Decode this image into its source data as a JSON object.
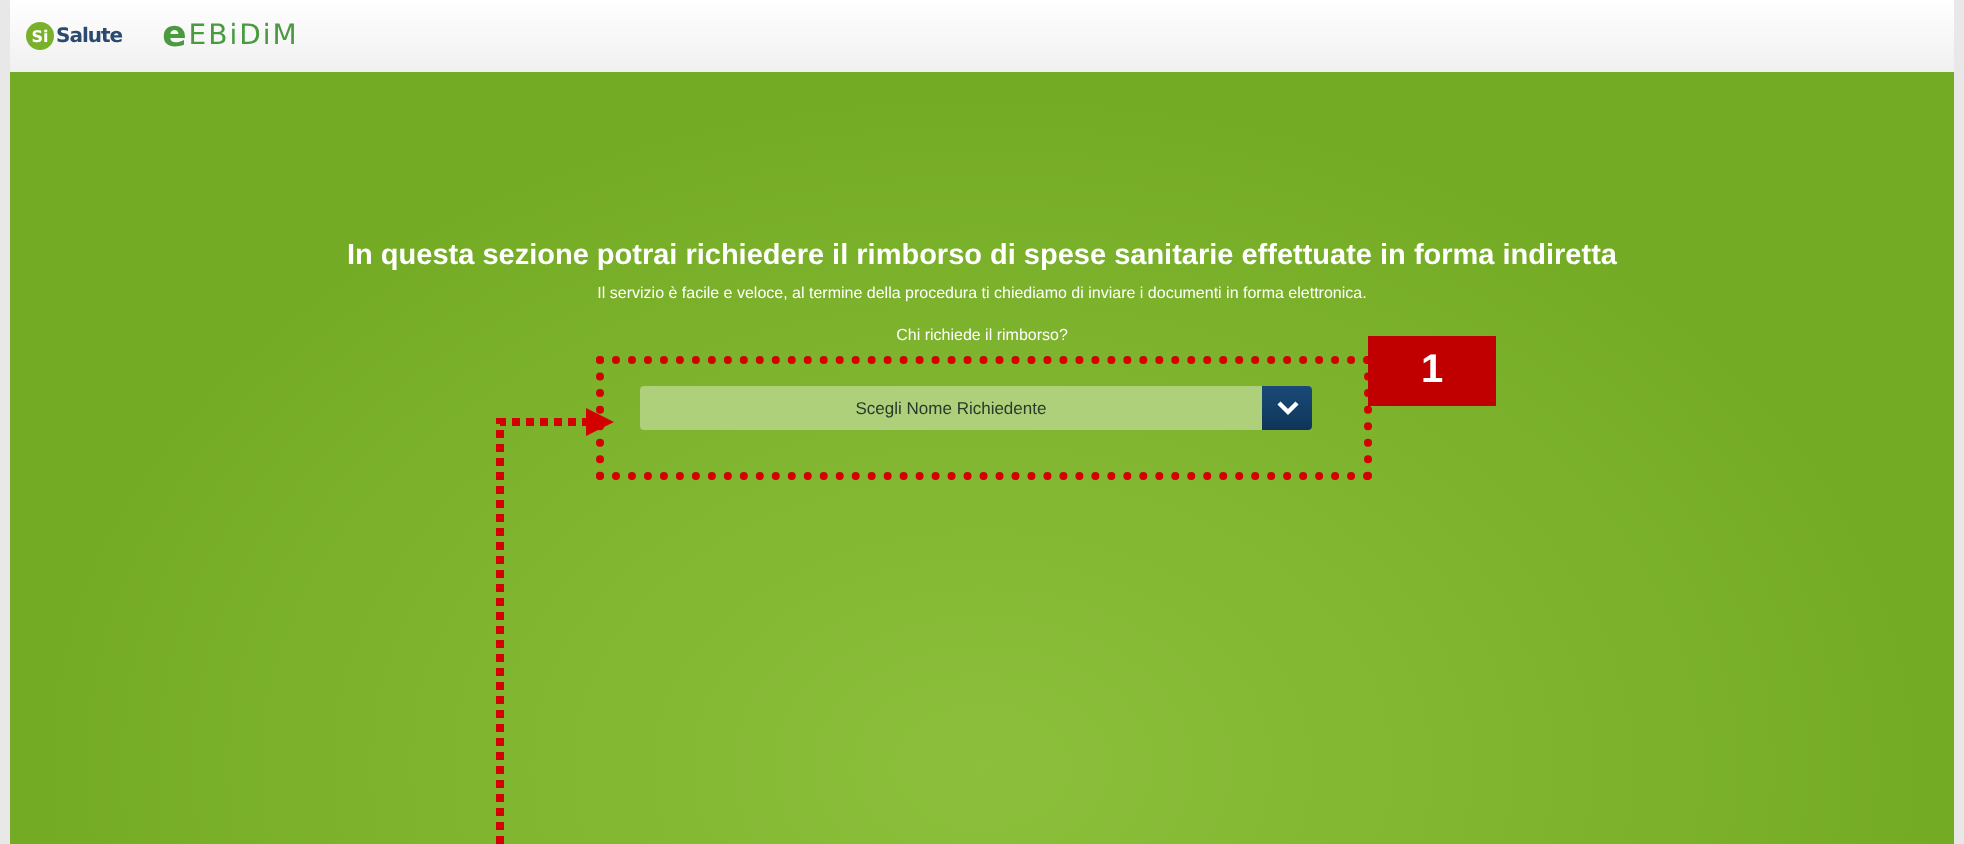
{
  "header": {
    "logos": [
      {
        "mark": "Si",
        "name": "Salute"
      },
      {
        "mark": "e",
        "name": "EBiDiM"
      }
    ]
  },
  "intro": {
    "title": "In questa sezione potrai richiedere il rimborso di spese sanitarie effettuate in forma indiretta",
    "subtitle": "Il servizio è facile e veloce, al termine della procedura ti chiediamo di inviare i documenti in forma elettronica.",
    "question": "Chi richiede il rimborso?"
  },
  "select": {
    "placeholder": "Scegli Nome Richiedente"
  },
  "callout": {
    "number": "1"
  }
}
